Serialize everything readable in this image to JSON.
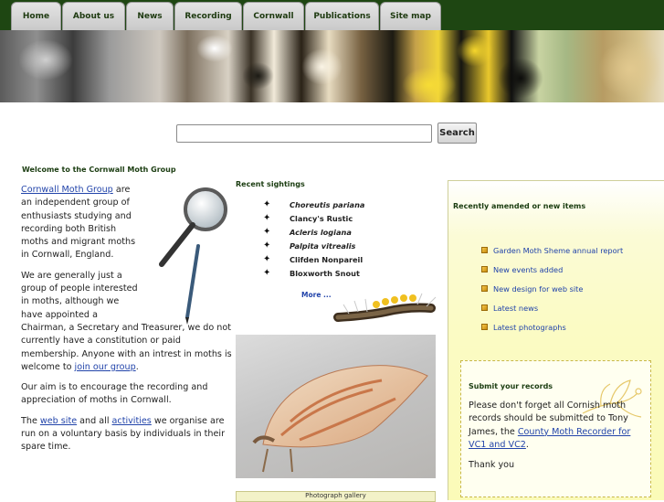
{
  "nav": {
    "tabs": [
      {
        "label": "Home"
      },
      {
        "label": "About us"
      },
      {
        "label": "News"
      },
      {
        "label": "Recording"
      },
      {
        "label": "Cornwall"
      },
      {
        "label": "Publications"
      },
      {
        "label": "Site map"
      }
    ]
  },
  "search": {
    "value": "",
    "button_label": "Search"
  },
  "welcome": {
    "title": "Welcome to the Cornwall Moth Group",
    "p1_link": "Cornwall Moth Group",
    "p1_text": " are an independent group of enthusiasts studying and recording both British moths and migrant moths in Cornwall, England.",
    "p2_text": "We are generally just a group of people interested in moths, although we have appointed a Chairman, a Secretary and Treasurer, we do not currently have a constitution or paid membership. Anyone with an intrest in moths is welcome to ",
    "p2_link": "join our group",
    "p2_end": ".",
    "p3_text": "Our aim is to encourage the recording and appreciation of moths in Cornwall.",
    "p4_a": "The ",
    "p4_link1": "web site",
    "p4_b": " and all ",
    "p4_link2": "activities",
    "p4_c": " we organise are run on a voluntary basis by individuals in their spare time."
  },
  "sightings": {
    "title": "Recent sightings",
    "items": [
      {
        "name": "Choreutis pariana",
        "italic": true
      },
      {
        "name": "Clancy's Rustic",
        "italic": false
      },
      {
        "name": "Acleris logiana",
        "italic": true
      },
      {
        "name": "Palpita vitrealis",
        "italic": true
      },
      {
        "name": "Clifden Nonpareil",
        "italic": false
      },
      {
        "name": "Bloxworth Snout",
        "italic": false
      }
    ],
    "more": "More ...",
    "icon": "moth-icon"
  },
  "gallery": {
    "label": "Photograph gallery"
  },
  "recent": {
    "title": "Recently amended or new items",
    "items": [
      "Garden Moth Sheme annual report",
      "New events added",
      "New design for web site",
      "Latest news",
      "Latest photographs"
    ]
  },
  "submit": {
    "title": "Submit your records",
    "text": "Please don't forget all Cornish moth records should be submitted to Tony James, the ",
    "link": "County Moth Recorder for VC1 and VC2",
    "end": ".",
    "thanks": "Thank you"
  },
  "colors": {
    "nav_bg": "#1e4612",
    "heading": "#1a3c10",
    "link": "#2244aa",
    "panel_bg": "#fbfbc4"
  }
}
